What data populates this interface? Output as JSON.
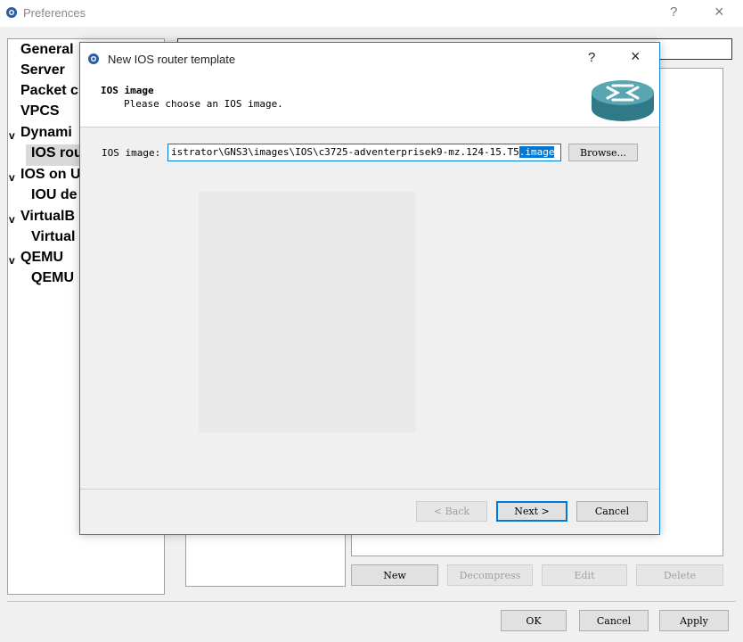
{
  "window": {
    "title": "Preferences",
    "help_glyph": "?",
    "close_glyph": "×",
    "logo_icon": "gns3-logo-icon"
  },
  "sidebar": {
    "items": [
      {
        "label": "General",
        "expanded": null
      },
      {
        "label": "Server",
        "expanded": null
      },
      {
        "label": "Packet c",
        "expanded": null
      },
      {
        "label": "VPCS",
        "expanded": null
      },
      {
        "label": "Dynami",
        "expanded": true
      },
      {
        "label": "IOS rou",
        "expanded": null,
        "selected": true
      },
      {
        "label": "IOS on U",
        "expanded": true
      },
      {
        "label": "IOU de",
        "expanded": null
      },
      {
        "label": "VirtualB",
        "expanded": true
      },
      {
        "label": "Virtual",
        "expanded": null
      },
      {
        "label": "QEMU",
        "expanded": true
      },
      {
        "label": "QEMU",
        "expanded": null
      }
    ]
  },
  "search_strip": {
    "text": ""
  },
  "actions": {
    "new": "New",
    "decompress": "Decompress",
    "edit": "Edit",
    "delete": "Delete"
  },
  "footer": {
    "ok": "OK",
    "cancel": "Cancel",
    "apply": "Apply"
  },
  "dialog": {
    "title": "New IOS router template",
    "help_glyph": "?",
    "close_glyph": "×",
    "header_title": "IOS image",
    "header_subtitle": "Please choose an IOS image.",
    "router_icon": "router-icon",
    "ios_image_label": "IOS image:",
    "ios_image_value": "istrator\\GNS3\\images\\IOS\\c3725-adventerprisek9-mz.124-15.T5",
    "ios_image_selected": ".image",
    "browse": "Browse...",
    "back": "< Back",
    "next": "Next >",
    "cancel": "Cancel"
  },
  "colors": {
    "accent": "#0078d7",
    "router_teal": "#4a9aa5"
  }
}
